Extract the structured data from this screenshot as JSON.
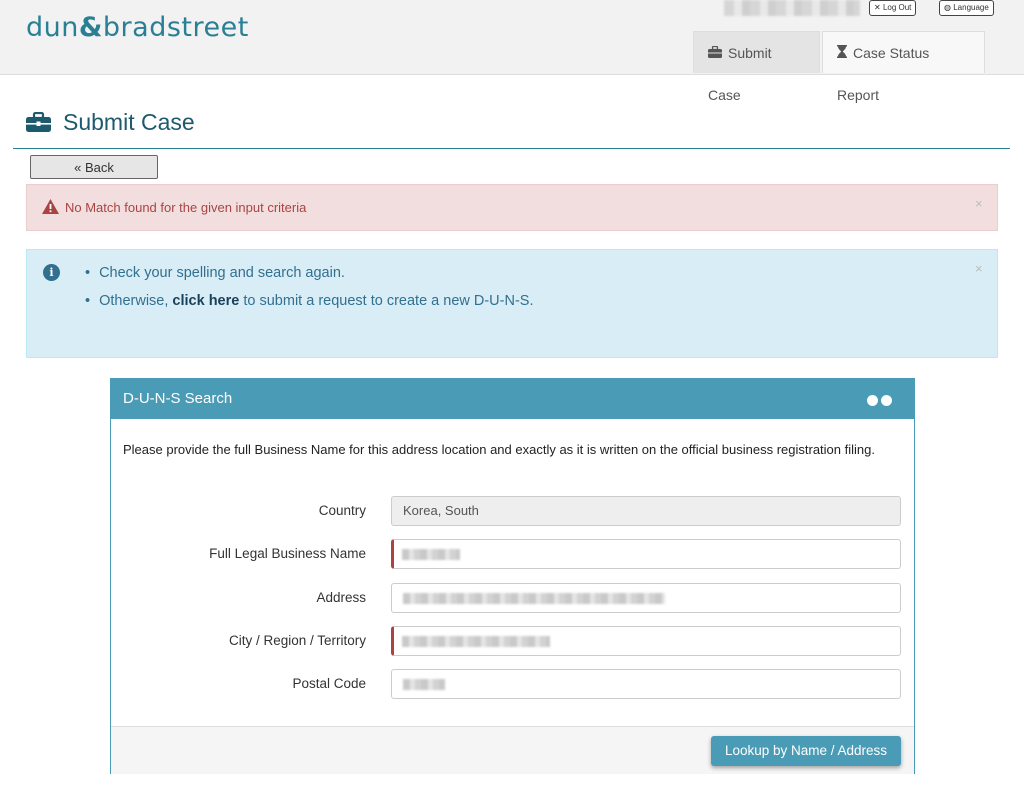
{
  "header": {
    "logo": {
      "part1": "dun",
      "amp": "&",
      "part2": "bradstreet"
    },
    "logout_label": "Log Out",
    "language_label": "Language",
    "tabs": [
      {
        "label": "Submit Case",
        "icon": "briefcase-icon"
      },
      {
        "label": "Case Status Report",
        "icon": "hourglass-icon"
      }
    ]
  },
  "page": {
    "title": "Submit Case",
    "title_icon": "briefcase-icon",
    "back_label": "« Back"
  },
  "alerts": {
    "error": {
      "message": "No Match found for the given input criteria",
      "icon": "warning-icon",
      "close": "×"
    },
    "info": {
      "icon": "info-icon",
      "close": "×",
      "line1": "Check your spelling and search again.",
      "line2_prefix": "Otherwise, ",
      "line2_link": "click here",
      "line2_suffix": " to submit a request to create a new D-U-N-S."
    }
  },
  "duns_search": {
    "title": "D-U-N-S Search",
    "instructions": "Please provide the full Business Name for this address location and exactly as it is written on the official business registration filing.",
    "fields": {
      "country": {
        "label": "Country",
        "value": "Korea, South"
      },
      "business_name": {
        "label": "Full Legal Business Name"
      },
      "address": {
        "label": "Address"
      },
      "city": {
        "label": "City / Region / Territory"
      },
      "postal_code": {
        "label": "Postal Code"
      }
    },
    "submit_label": "Lookup by Name / Address"
  },
  "colors": {
    "brand": "#2a7f95",
    "panel_header": "#4a9bb5",
    "error_bg": "#f2dede",
    "info_bg": "#d9edf7"
  }
}
